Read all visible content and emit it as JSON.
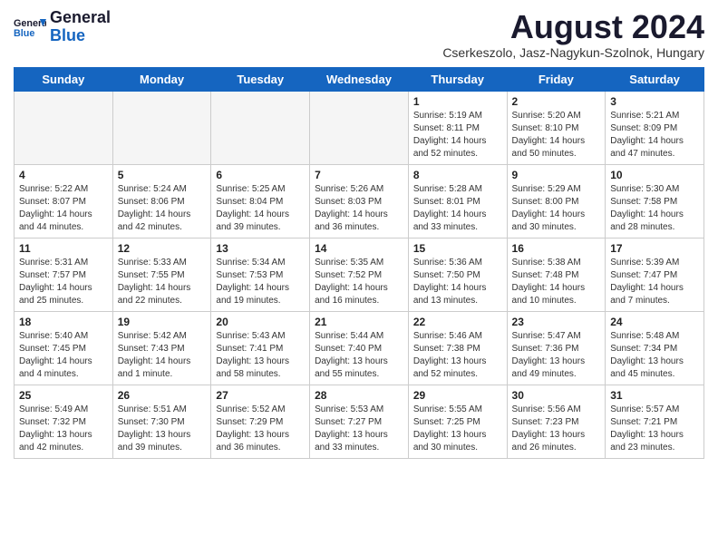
{
  "header": {
    "logo_general": "General",
    "logo_blue": "Blue",
    "month_year": "August 2024",
    "location": "Cserkeszolo, Jasz-Nagykun-Szolnok, Hungary"
  },
  "weekdays": [
    "Sunday",
    "Monday",
    "Tuesday",
    "Wednesday",
    "Thursday",
    "Friday",
    "Saturday"
  ],
  "weeks": [
    [
      {
        "day": "",
        "info": "",
        "empty": true
      },
      {
        "day": "",
        "info": "",
        "empty": true
      },
      {
        "day": "",
        "info": "",
        "empty": true
      },
      {
        "day": "",
        "info": "",
        "empty": true
      },
      {
        "day": "1",
        "info": "Sunrise: 5:19 AM\nSunset: 8:11 PM\nDaylight: 14 hours\nand 52 minutes.",
        "empty": false
      },
      {
        "day": "2",
        "info": "Sunrise: 5:20 AM\nSunset: 8:10 PM\nDaylight: 14 hours\nand 50 minutes.",
        "empty": false
      },
      {
        "day": "3",
        "info": "Sunrise: 5:21 AM\nSunset: 8:09 PM\nDaylight: 14 hours\nand 47 minutes.",
        "empty": false
      }
    ],
    [
      {
        "day": "4",
        "info": "Sunrise: 5:22 AM\nSunset: 8:07 PM\nDaylight: 14 hours\nand 44 minutes.",
        "empty": false
      },
      {
        "day": "5",
        "info": "Sunrise: 5:24 AM\nSunset: 8:06 PM\nDaylight: 14 hours\nand 42 minutes.",
        "empty": false
      },
      {
        "day": "6",
        "info": "Sunrise: 5:25 AM\nSunset: 8:04 PM\nDaylight: 14 hours\nand 39 minutes.",
        "empty": false
      },
      {
        "day": "7",
        "info": "Sunrise: 5:26 AM\nSunset: 8:03 PM\nDaylight: 14 hours\nand 36 minutes.",
        "empty": false
      },
      {
        "day": "8",
        "info": "Sunrise: 5:28 AM\nSunset: 8:01 PM\nDaylight: 14 hours\nand 33 minutes.",
        "empty": false
      },
      {
        "day": "9",
        "info": "Sunrise: 5:29 AM\nSunset: 8:00 PM\nDaylight: 14 hours\nand 30 minutes.",
        "empty": false
      },
      {
        "day": "10",
        "info": "Sunrise: 5:30 AM\nSunset: 7:58 PM\nDaylight: 14 hours\nand 28 minutes.",
        "empty": false
      }
    ],
    [
      {
        "day": "11",
        "info": "Sunrise: 5:31 AM\nSunset: 7:57 PM\nDaylight: 14 hours\nand 25 minutes.",
        "empty": false
      },
      {
        "day": "12",
        "info": "Sunrise: 5:33 AM\nSunset: 7:55 PM\nDaylight: 14 hours\nand 22 minutes.",
        "empty": false
      },
      {
        "day": "13",
        "info": "Sunrise: 5:34 AM\nSunset: 7:53 PM\nDaylight: 14 hours\nand 19 minutes.",
        "empty": false
      },
      {
        "day": "14",
        "info": "Sunrise: 5:35 AM\nSunset: 7:52 PM\nDaylight: 14 hours\nand 16 minutes.",
        "empty": false
      },
      {
        "day": "15",
        "info": "Sunrise: 5:36 AM\nSunset: 7:50 PM\nDaylight: 14 hours\nand 13 minutes.",
        "empty": false
      },
      {
        "day": "16",
        "info": "Sunrise: 5:38 AM\nSunset: 7:48 PM\nDaylight: 14 hours\nand 10 minutes.",
        "empty": false
      },
      {
        "day": "17",
        "info": "Sunrise: 5:39 AM\nSunset: 7:47 PM\nDaylight: 14 hours\nand 7 minutes.",
        "empty": false
      }
    ],
    [
      {
        "day": "18",
        "info": "Sunrise: 5:40 AM\nSunset: 7:45 PM\nDaylight: 14 hours\nand 4 minutes.",
        "empty": false
      },
      {
        "day": "19",
        "info": "Sunrise: 5:42 AM\nSunset: 7:43 PM\nDaylight: 14 hours\nand 1 minute.",
        "empty": false
      },
      {
        "day": "20",
        "info": "Sunrise: 5:43 AM\nSunset: 7:41 PM\nDaylight: 13 hours\nand 58 minutes.",
        "empty": false
      },
      {
        "day": "21",
        "info": "Sunrise: 5:44 AM\nSunset: 7:40 PM\nDaylight: 13 hours\nand 55 minutes.",
        "empty": false
      },
      {
        "day": "22",
        "info": "Sunrise: 5:46 AM\nSunset: 7:38 PM\nDaylight: 13 hours\nand 52 minutes.",
        "empty": false
      },
      {
        "day": "23",
        "info": "Sunrise: 5:47 AM\nSunset: 7:36 PM\nDaylight: 13 hours\nand 49 minutes.",
        "empty": false
      },
      {
        "day": "24",
        "info": "Sunrise: 5:48 AM\nSunset: 7:34 PM\nDaylight: 13 hours\nand 45 minutes.",
        "empty": false
      }
    ],
    [
      {
        "day": "25",
        "info": "Sunrise: 5:49 AM\nSunset: 7:32 PM\nDaylight: 13 hours\nand 42 minutes.",
        "empty": false
      },
      {
        "day": "26",
        "info": "Sunrise: 5:51 AM\nSunset: 7:30 PM\nDaylight: 13 hours\nand 39 minutes.",
        "empty": false
      },
      {
        "day": "27",
        "info": "Sunrise: 5:52 AM\nSunset: 7:29 PM\nDaylight: 13 hours\nand 36 minutes.",
        "empty": false
      },
      {
        "day": "28",
        "info": "Sunrise: 5:53 AM\nSunset: 7:27 PM\nDaylight: 13 hours\nand 33 minutes.",
        "empty": false
      },
      {
        "day": "29",
        "info": "Sunrise: 5:55 AM\nSunset: 7:25 PM\nDaylight: 13 hours\nand 30 minutes.",
        "empty": false
      },
      {
        "day": "30",
        "info": "Sunrise: 5:56 AM\nSunset: 7:23 PM\nDaylight: 13 hours\nand 26 minutes.",
        "empty": false
      },
      {
        "day": "31",
        "info": "Sunrise: 5:57 AM\nSunset: 7:21 PM\nDaylight: 13 hours\nand 23 minutes.",
        "empty": false
      }
    ]
  ]
}
